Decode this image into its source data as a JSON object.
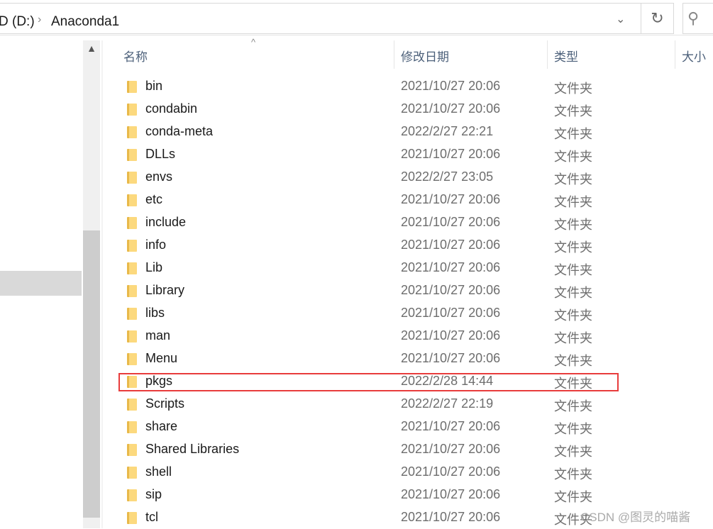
{
  "address": {
    "drive": "D (D:)",
    "folder": "Anaconda1"
  },
  "columns": {
    "name": "名称",
    "modified": "修改日期",
    "type": "类型",
    "size": "大小"
  },
  "rows": [
    {
      "name": "bin",
      "date": "2021/10/27 20:06",
      "type": "文件夹"
    },
    {
      "name": "condabin",
      "date": "2021/10/27 20:06",
      "type": "文件夹"
    },
    {
      "name": "conda-meta",
      "date": "2022/2/27 22:21",
      "type": "文件夹"
    },
    {
      "name": "DLLs",
      "date": "2021/10/27 20:06",
      "type": "文件夹"
    },
    {
      "name": "envs",
      "date": "2022/2/27 23:05",
      "type": "文件夹"
    },
    {
      "name": "etc",
      "date": "2021/10/27 20:06",
      "type": "文件夹"
    },
    {
      "name": "include",
      "date": "2021/10/27 20:06",
      "type": "文件夹"
    },
    {
      "name": "info",
      "date": "2021/10/27 20:06",
      "type": "文件夹"
    },
    {
      "name": "Lib",
      "date": "2021/10/27 20:06",
      "type": "文件夹"
    },
    {
      "name": "Library",
      "date": "2021/10/27 20:06",
      "type": "文件夹"
    },
    {
      "name": "libs",
      "date": "2021/10/27 20:06",
      "type": "文件夹"
    },
    {
      "name": "man",
      "date": "2021/10/27 20:06",
      "type": "文件夹"
    },
    {
      "name": "Menu",
      "date": "2021/10/27 20:06",
      "type": "文件夹"
    },
    {
      "name": "pkgs",
      "date": "2022/2/28 14:44",
      "type": "文件夹",
      "highlighted": true
    },
    {
      "name": "Scripts",
      "date": "2022/2/27 22:19",
      "type": "文件夹"
    },
    {
      "name": "share",
      "date": "2021/10/27 20:06",
      "type": "文件夹"
    },
    {
      "name": "Shared Libraries",
      "date": "2021/10/27 20:06",
      "type": "文件夹"
    },
    {
      "name": "shell",
      "date": "2021/10/27 20:06",
      "type": "文件夹"
    },
    {
      "name": "sip",
      "date": "2021/10/27 20:06",
      "type": "文件夹"
    },
    {
      "name": "tcl",
      "date": "2021/10/27 20:06",
      "type": "文件夹"
    }
  ],
  "highlight_color": "#e83c3c",
  "watermark": "CSDN @图灵的喵酱"
}
